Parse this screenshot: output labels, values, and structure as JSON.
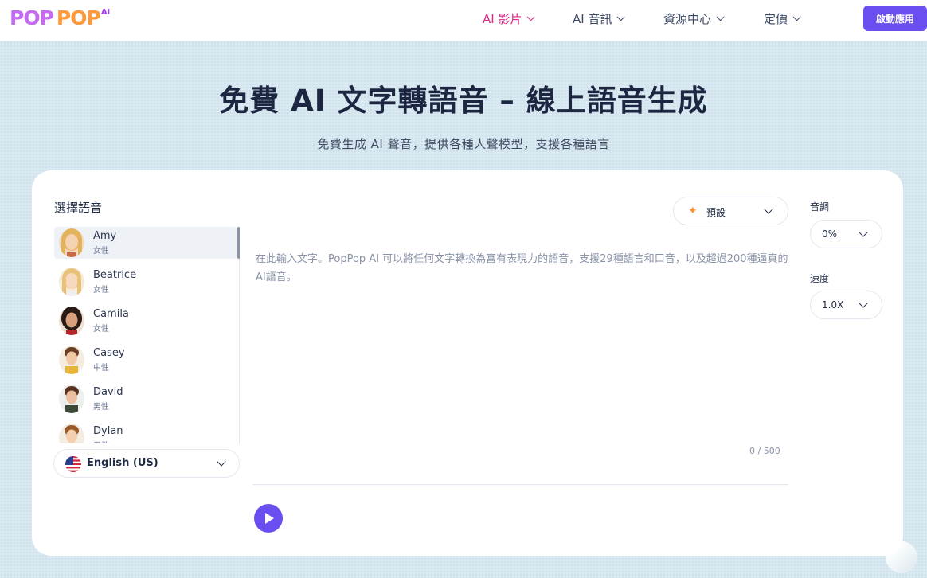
{
  "header": {
    "logo_word1": "POP",
    "logo_word2": "POP",
    "logo_sup": "AI",
    "nav": [
      {
        "label": "AI 影片",
        "active": true
      },
      {
        "label": "AI 音訊",
        "active": false
      },
      {
        "label": "資源中心",
        "active": false
      },
      {
        "label": "定價",
        "active": false
      }
    ],
    "cta_label": "啟動應用"
  },
  "hero": {
    "title": "免費 AI 文字轉語音 – 線上語音生成",
    "subtitle": "免費生成 AI 聲音，提供各種人聲模型，支援各種語言"
  },
  "voice_panel": {
    "title": "選擇語音",
    "voices": [
      {
        "name": "Amy",
        "gender": "女性",
        "selected": true
      },
      {
        "name": "Beatrice",
        "gender": "女性",
        "selected": false
      },
      {
        "name": "Camila",
        "gender": "女性",
        "selected": false
      },
      {
        "name": "Casey",
        "gender": "中性",
        "selected": false
      },
      {
        "name": "David",
        "gender": "男性",
        "selected": false
      },
      {
        "name": "Dylan",
        "gender": "男性",
        "selected": false
      }
    ],
    "language": "English (US)"
  },
  "editor": {
    "preset_label": "預設",
    "placeholder": "在此輸入文字。PopPop AI 可以將任何文字轉換為富有表現力的語音，支援29種語言和口音，以及超過200種逼真的AI語音。",
    "counter": "0 / 500"
  },
  "settings": {
    "pitch_label": "音調",
    "pitch_value": "0%",
    "speed_label": "速度",
    "speed_value": "1.0X"
  },
  "colors": {
    "accent": "#6b4ef0",
    "nav_active": "#e0288a"
  }
}
